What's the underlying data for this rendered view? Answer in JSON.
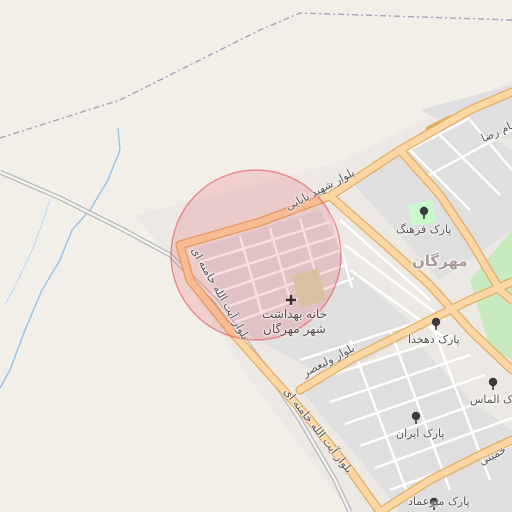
{
  "map": {
    "district": "مهرگان",
    "roads": {
      "blvd_shahid_babaei": "بلوار شهید بابایی",
      "blvd_ayatollah_khamenei_upper": "بلوار آیت الله خامنه ای",
      "blvd_ayatollah_khamenei_lower": "بلوار آیت الله خامنه ای",
      "blvd_valiasr": "بلوار ولیعصر",
      "imam_reza": "امام رضا",
      "khomeini": "خمینی"
    },
    "pois": {
      "health_center_line1": "خانه بهداشت",
      "health_center_line2": "شهر مهرگان",
      "park_farhang": "پارک فرهنگ",
      "park_dehkhoda": "پارک دهخدا",
      "park_almas": "پارک الماس",
      "park_iran": "پارک ایران",
      "park_mirmad": "پارک میرعماد"
    },
    "icons": {
      "hospital": "hospital-cross-icon",
      "park": "tree-icon"
    },
    "colors": {
      "land": "#f2efe9",
      "residential": "#e0dfdf",
      "major_road": "#fcd6a4",
      "major_road_casing": "#e8b56a",
      "minor_road": "#ffffff",
      "park": "#c8facc",
      "highlight_circle": "#e8424f",
      "admin_boundary": "#9e9cab",
      "waterway": "#7ab4e6",
      "railway": "#b5b5b5"
    }
  }
}
